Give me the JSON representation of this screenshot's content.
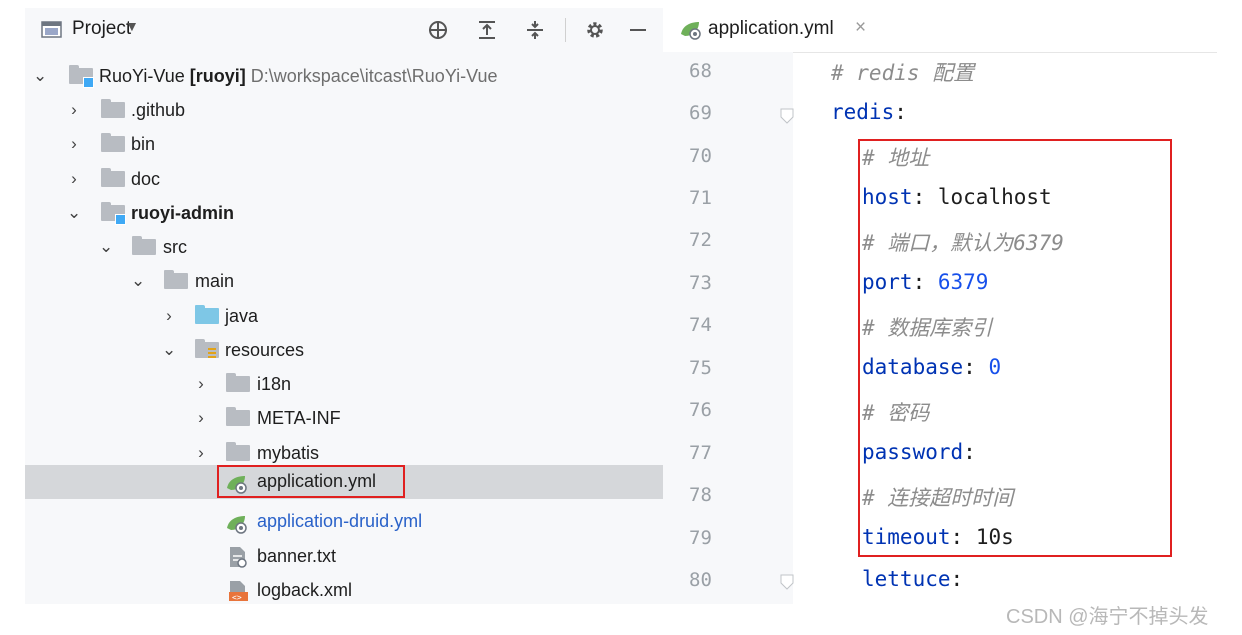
{
  "project_panel": {
    "title": "Project",
    "caret": "▼",
    "toolbar_icons": [
      "crosshair-icon",
      "expand-all-icon",
      "collapse-all-icon",
      "gear-icon",
      "minimize-icon"
    ]
  },
  "tree": {
    "root_name": "RuoYi-Vue",
    "root_module": "[ruoyi]",
    "root_path": "D:\\workspace\\itcast\\RuoYi-Vue",
    "items": [
      {
        "label": "RuoYi-Vue"
      },
      {
        "label": ".github"
      },
      {
        "label": "bin"
      },
      {
        "label": "doc"
      },
      {
        "label": "ruoyi-admin"
      },
      {
        "label": "src"
      },
      {
        "label": "main"
      },
      {
        "label": "java"
      },
      {
        "label": "resources"
      },
      {
        "label": "i18n"
      },
      {
        "label": "META-INF"
      },
      {
        "label": "mybatis"
      },
      {
        "label": "application.yml"
      },
      {
        "label": "application-druid.yml"
      },
      {
        "label": "banner.txt"
      },
      {
        "label": "logback.xml"
      }
    ]
  },
  "editor": {
    "tab_label": "application.yml",
    "tab_close": "×",
    "lines": [
      {
        "num": "68",
        "text": "# redis 配置"
      },
      {
        "num": "69",
        "key": "redis",
        "colon": ":"
      },
      {
        "num": "70",
        "text": "# 地址"
      },
      {
        "num": "71",
        "key": "host",
        "colon": ": ",
        "value": "localhost"
      },
      {
        "num": "72",
        "text": "# 端口，默认为6379"
      },
      {
        "num": "73",
        "key": "port",
        "colon": ": ",
        "value": "6379"
      },
      {
        "num": "74",
        "text": "# 数据库索引"
      },
      {
        "num": "75",
        "key": "database",
        "colon": ": ",
        "value": "0"
      },
      {
        "num": "76",
        "text": "# 密码"
      },
      {
        "num": "77",
        "key": "password",
        "colon": ":"
      },
      {
        "num": "78",
        "text": "# 连接超时时间"
      },
      {
        "num": "79",
        "key": "timeout",
        "colon": ": ",
        "value": "10s"
      },
      {
        "num": "80",
        "key": "lettuce",
        "colon": ":"
      }
    ]
  },
  "watermark": "CSDN @海宁不掉头发",
  "colors": {
    "selection_outline": "#e02020",
    "yaml_key": "#0033b3",
    "yaml_number": "#1750eb",
    "comment": "#8c8c8c",
    "module_name_link": "#2a62c9"
  }
}
